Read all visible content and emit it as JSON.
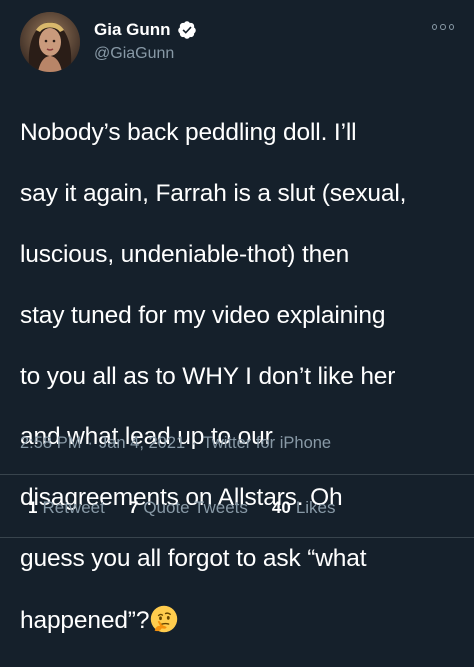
{
  "user": {
    "display_name": "Gia Gunn",
    "handle": "@GiaGunn",
    "verified": true,
    "avatar_icon": "profile-photo"
  },
  "tweet": {
    "lines": [
      "Nobody’s back peddling doll.  I’ll",
      "say it again, Farrah is a slut (sexual,",
      "luscious, undeniable-thot) then",
      "stay tuned for my video explaining",
      "to you all as to WHY I don’t like her",
      "and what lead up to our",
      "disagreements on Allstars. Oh",
      "guess you all forgot to ask “what",
      "happened”?"
    ],
    "emoji": "thinking-face-emoji"
  },
  "meta": {
    "time": "2:58 PM",
    "separator": "·",
    "date": "Jan 4, 2021",
    "source": "Twitter for iPhone"
  },
  "stats": {
    "retweets": {
      "count": "1",
      "label": "Retweet"
    },
    "quote_tweets": {
      "count": "7",
      "label": "Quote Tweets"
    },
    "likes": {
      "count": "40",
      "label": "Likes"
    }
  },
  "colors": {
    "background": "#15202b",
    "text": "#ffffff",
    "secondary": "#8899a6",
    "divider": "#38444d",
    "verified": "#ffffff"
  }
}
